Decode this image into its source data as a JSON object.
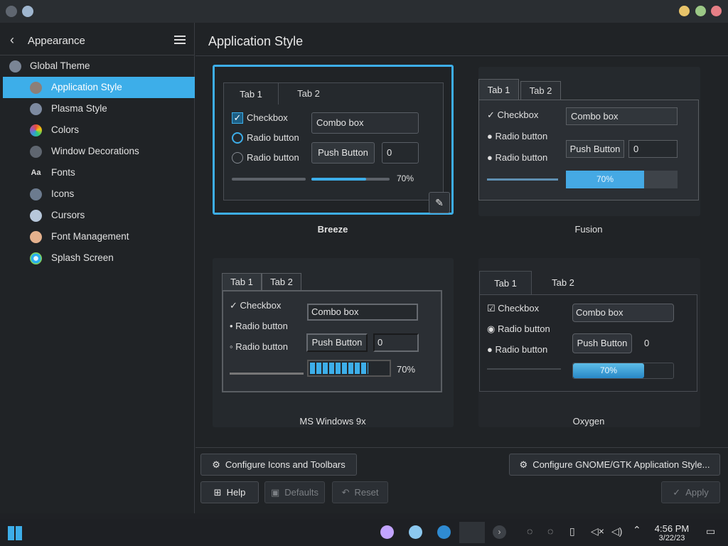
{
  "window": {
    "title_icon": "app-icon",
    "controls": [
      "minimize",
      "maximize",
      "close"
    ]
  },
  "sidebar": {
    "back_label": "Appearance",
    "items": [
      {
        "label": "Global Theme",
        "icon": "global-theme-icon",
        "selected": false,
        "level": "root"
      },
      {
        "label": "Application Style",
        "icon": "application-style-icon",
        "selected": true,
        "level": "child"
      },
      {
        "label": "Plasma Style",
        "icon": "plasma-style-icon",
        "selected": false,
        "level": "child"
      },
      {
        "label": "Colors",
        "icon": "colors-icon",
        "selected": false,
        "level": "child"
      },
      {
        "label": "Window Decorations",
        "icon": "window-decorations-icon",
        "selected": false,
        "level": "child"
      },
      {
        "label": "Fonts",
        "icon": "fonts-icon",
        "selected": false,
        "level": "child"
      },
      {
        "label": "Icons",
        "icon": "icons-icon",
        "selected": false,
        "level": "child"
      },
      {
        "label": "Cursors",
        "icon": "cursors-icon",
        "selected": false,
        "level": "child"
      },
      {
        "label": "Font Management",
        "icon": "font-management-icon",
        "selected": false,
        "level": "child"
      },
      {
        "label": "Splash Screen",
        "icon": "splash-screen-icon",
        "selected": false,
        "level": "child"
      }
    ]
  },
  "main": {
    "title": "Application Style",
    "styles": [
      {
        "name": "Breeze",
        "selected": true
      },
      {
        "name": "Fusion",
        "selected": false
      },
      {
        "name": "MS Windows 9x",
        "selected": false
      },
      {
        "name": "Oxygen",
        "selected": false
      }
    ],
    "preview": {
      "tab1": "Tab 1",
      "tab2": "Tab 2",
      "checkbox": "Checkbox",
      "radio": "Radio button",
      "combo": "Combo box",
      "push": "Push Button",
      "spin": "0",
      "progress": "70%"
    },
    "buttons": {
      "configure_icons": "Configure Icons and Toolbars",
      "configure_gtk": "Configure GNOME/GTK Application Style...",
      "help": "Help",
      "defaults": "Defaults",
      "reset": "Reset",
      "apply": "Apply"
    }
  },
  "taskbar": {
    "time": "4:56 PM",
    "date": "3/22/23",
    "apps": [
      "start-icon",
      "plasma-icon",
      "browser-icon",
      "settings-icon",
      "system-settings-icon",
      "arrow-icon"
    ],
    "tray": [
      "user-icon",
      "users-icon",
      "clipboard-icon",
      "mute-icon",
      "volume-icon",
      "up-arrow-icon",
      "desktop-icon"
    ]
  },
  "colors": {
    "accent": "#3daee9",
    "window": "#202326",
    "taskbar": "#1e2024"
  }
}
